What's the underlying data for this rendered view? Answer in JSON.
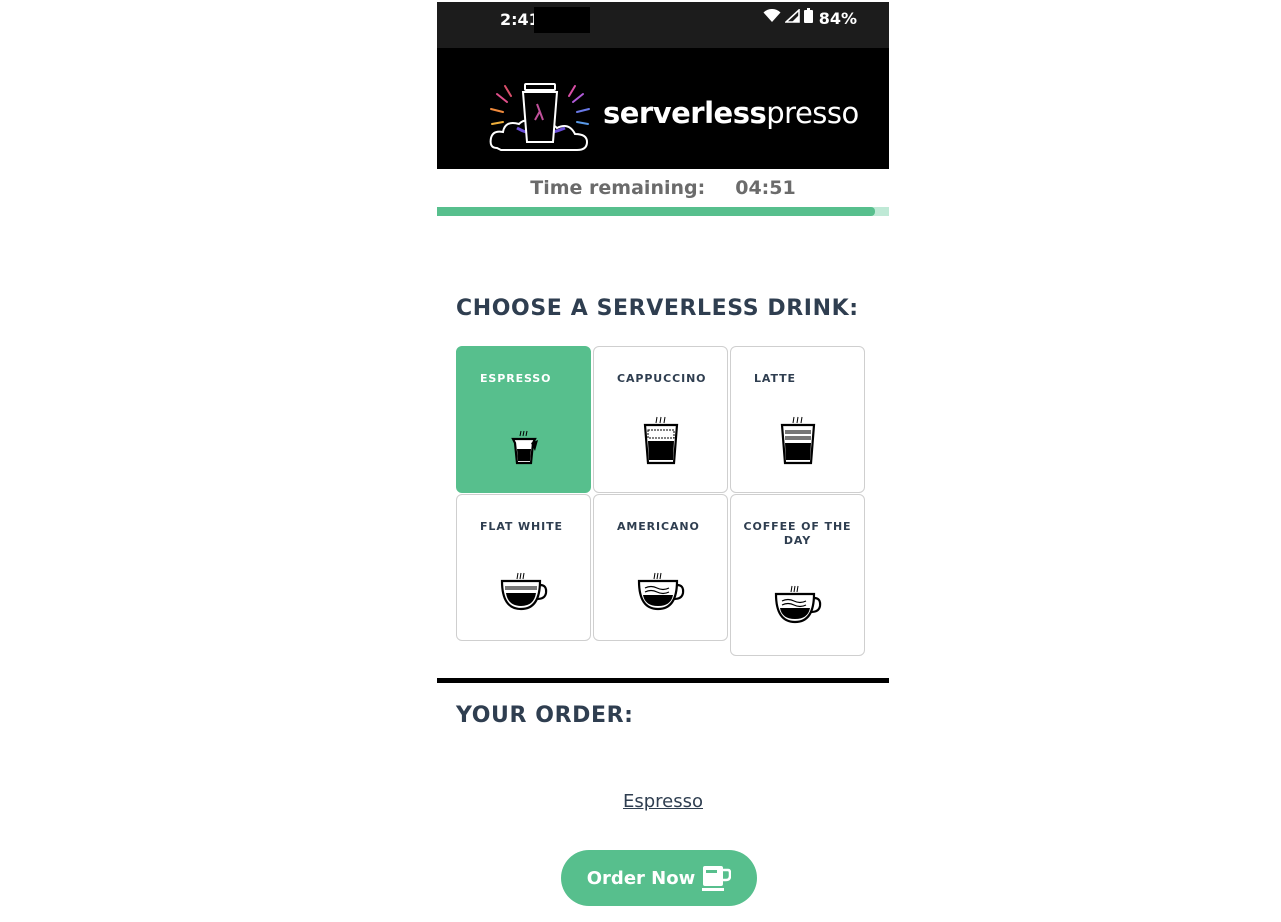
{
  "status_bar": {
    "time": "2:41",
    "battery": "84%",
    "icons": [
      "wifi-icon",
      "signal-icon",
      "battery-icon"
    ]
  },
  "banner": {
    "brand_bold": "serverless",
    "brand_light": "presso",
    "logo_icon": "coffee-cup-cloud-logo"
  },
  "timer": {
    "label": "Time remaining:",
    "value": "04:51",
    "progress_fraction": 0.97
  },
  "menu": {
    "title": "CHOOSE A SERVERLESS DRINK:",
    "drinks": [
      {
        "label": "ESPRESSO",
        "icon": "espresso-cup-icon",
        "selected": true
      },
      {
        "label": "CAPPUCCINO",
        "icon": "cappuccino-cup-icon",
        "selected": false
      },
      {
        "label": "LATTE",
        "icon": "latte-cup-icon",
        "selected": false
      },
      {
        "label": "FLAT WHITE",
        "icon": "flat-white-cup-icon",
        "selected": false
      },
      {
        "label": "AMERICANO",
        "icon": "americano-cup-icon",
        "selected": false
      },
      {
        "label": "COFFEE OF THE DAY",
        "icon": "coffee-of-the-day-cup-icon",
        "selected": false
      }
    ]
  },
  "order": {
    "title": "YOUR ORDER:",
    "item": "Espresso",
    "button_label": "Order Now",
    "button_icon": "coffee-mug-icon"
  },
  "colors": {
    "accent": "#57bf8d",
    "heading": "#2f3e50",
    "banner_bg": "#000000",
    "statusbar_bg": "#1c1c1c"
  }
}
